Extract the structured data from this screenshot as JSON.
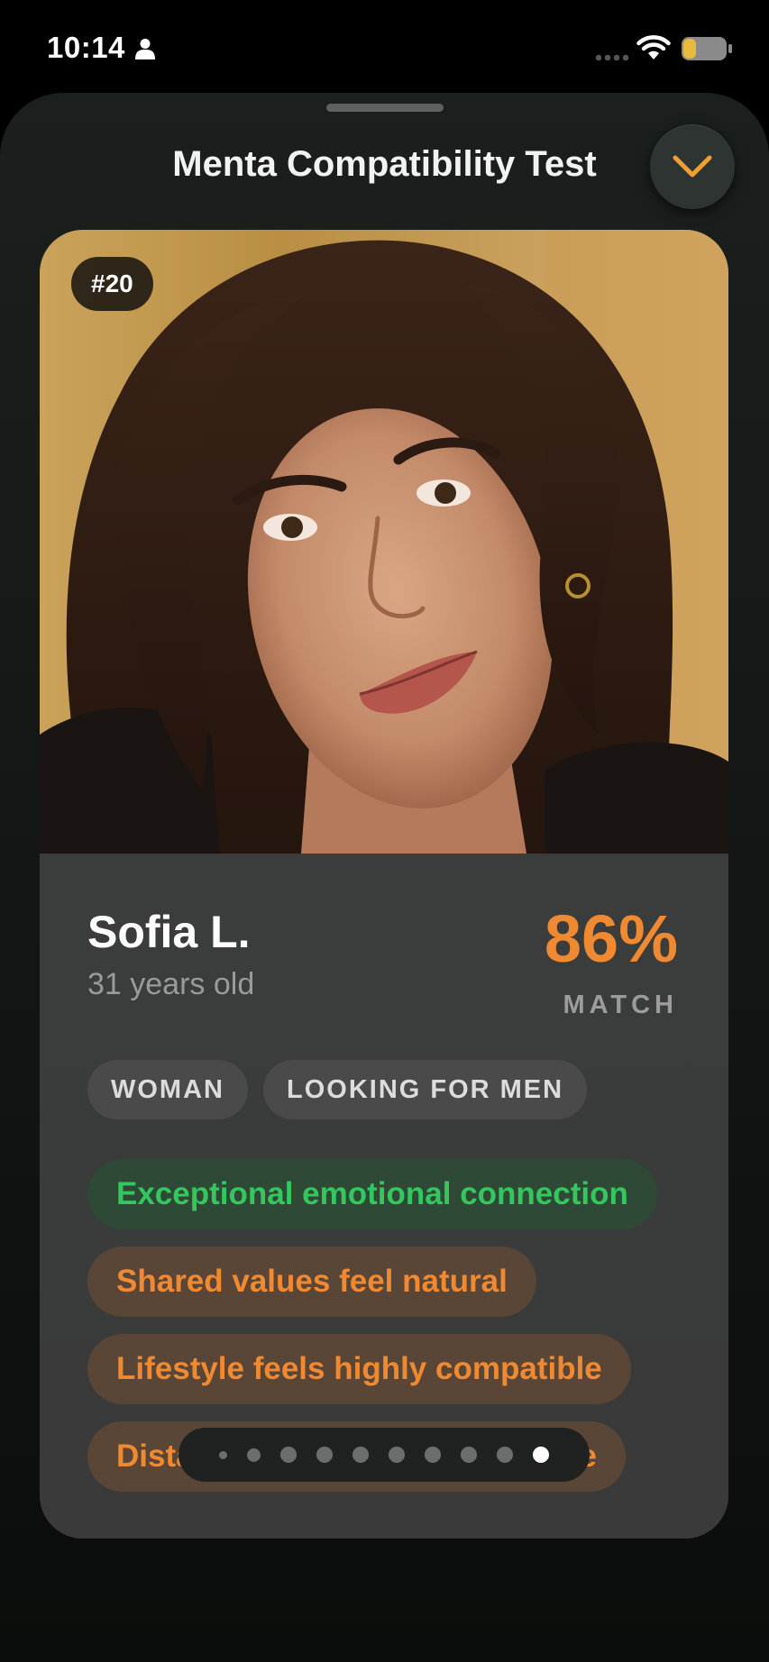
{
  "status_bar": {
    "time": "10:14",
    "icons": [
      "person-icon",
      "signal-icon",
      "wifi-icon",
      "battery-icon"
    ],
    "battery_color": "#e8b93a"
  },
  "sheet": {
    "title": "Menta Compatibility Test",
    "collapse_icon": "chevron-down-icon",
    "accent": "#f08a32"
  },
  "profile": {
    "rank": "#20",
    "name": "Sofia L.",
    "age": "31 years old",
    "match_percent": "86%",
    "match_label": "MATCH",
    "tags": [
      "WOMAN",
      "LOOKING FOR MEN"
    ],
    "insights": [
      {
        "text": "Exceptional emotional connection",
        "tone": "green"
      },
      {
        "text": "Shared values feel natural",
        "tone": "orange"
      },
      {
        "text": "Lifestyle feels highly compatible",
        "tone": "orange"
      },
      {
        "text": "Distance should be manageable",
        "tone": "orange"
      }
    ]
  },
  "pager": {
    "total": 10,
    "active_index": 9
  },
  "colors": {
    "green": "#33c75e",
    "orange": "#f08a32",
    "card_bg": "#3a3a3a"
  }
}
